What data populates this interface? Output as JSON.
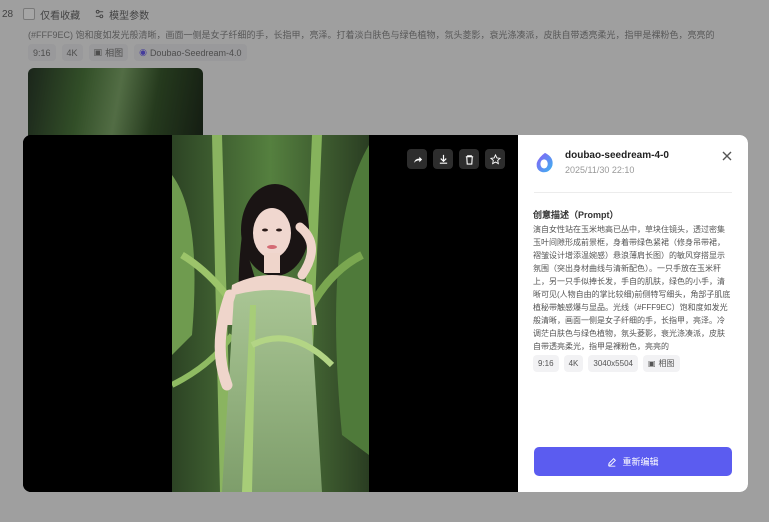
{
  "background": {
    "count_text": "28",
    "favorites_only_label": "仅看收藏",
    "model_params_label": "模型参数",
    "prompt_excerpt": "(#FFF9EC) 饱和度如发光般清晰，画面一侧是女子纤细的手，长指甲，亮泽。打着淡白肤色与绿色植物，氛头菱影，衰光涤凑派，皮肤自带透亮柔光，指甲是裸粉色，亮亮的",
    "tags": [
      "9:16",
      "4K",
      "相图",
      "Doubao-Seedream-4.0"
    ]
  },
  "viewer": {
    "tools": [
      "share-icon",
      "download-icon",
      "delete-icon",
      "star-icon"
    ]
  },
  "panel": {
    "model_name": "doubao-seedream-4-0",
    "timestamp": "2025/11/30 22:10",
    "prompt_title": "创意描述（Prompt）",
    "prompt_text": "演自女性站在玉米地高已丛中，草块住镜头，透过密集玉叶间隙形成前景框，身着带绿色紧裙（修身吊带裙，褶皱设计增添温婉感）悬浪薄肩长图）的敏风穿搭显示氛围（突出身材曲线与清新配色）。一只手放在玉米秆上，另一只手似捧长发，手自的肌肤，绿色的小手，清晰可见(人物自由的掌比较细)前侧特写细头，角部子肌底植秘带触感爆与显品。光线（#FFF9EC）饱和度如发光般清晰，画面一侧是女子纤细的手，长指甲，亮泽。冷调茫白肤色与绿色植物，氛头菱影，衰光涤凑派，皮肤自带透亮柔光，指甲是裸粉色，亮亮的",
    "tags": [
      "9:16",
      "4K",
      "3040x5504",
      "相图"
    ],
    "edit_button_label": "重新编辑"
  },
  "colors": {
    "accent": "#5b5cf0",
    "modal_bg": "#000000"
  }
}
